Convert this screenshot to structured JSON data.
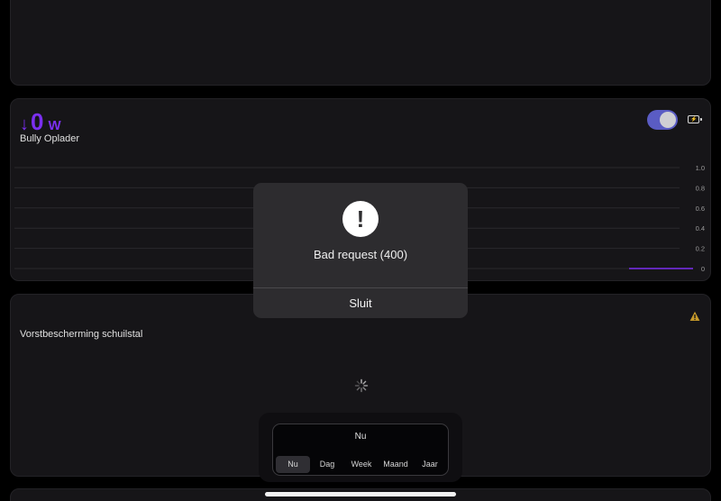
{
  "bully": {
    "arrow": "↓",
    "power_value": "0",
    "power_unit": "W",
    "name": "Bully Oplader",
    "toggle_on": true,
    "battery_icon": "battery-charging-icon"
  },
  "chart_data": {
    "type": "line",
    "title": "",
    "xlabel": "",
    "ylabel": "",
    "ylim": [
      0,
      1.0
    ],
    "y_ticks": [
      "1.0",
      "0.8",
      "0.6",
      "0.4",
      "0.2",
      "0"
    ],
    "series": [
      {
        "values": [
          0,
          0
        ]
      }
    ],
    "series_color": "#7b2ff0",
    "grid": true
  },
  "frost": {
    "name": "Vorstbescherming schuilstal",
    "warning_icon": "warning-triangle-icon",
    "loading_icon": "spinner-icon"
  },
  "modal": {
    "icon": "exclamation-icon",
    "message": "Bad request (400)",
    "close_label": "Sluit"
  },
  "period": {
    "selected": "Nu",
    "tabs": [
      "Nu",
      "Dag",
      "Week",
      "Maand",
      "Jaar"
    ],
    "active_index": 0
  }
}
